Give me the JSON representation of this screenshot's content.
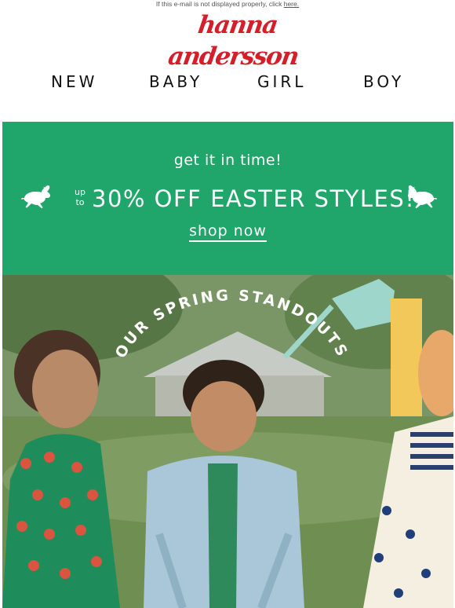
{
  "preheader": {
    "text": "If this e-mail is not displayed properly, click ",
    "link": "here."
  },
  "logo": {
    "text": "hanna andersson"
  },
  "nav": [
    {
      "label": "NEW"
    },
    {
      "label": "BABY"
    },
    {
      "label": "GIRL"
    },
    {
      "label": "BOY"
    }
  ],
  "banner": {
    "kicker": "get it in time!",
    "upto_line1": "up",
    "upto_line2": "to",
    "headline": "30% OFF EASTER STYLES!",
    "cta": "shop now",
    "bg_color": "#20a56a"
  },
  "hero": {
    "curved_title": "OUR SPRING STANDOUTS"
  }
}
